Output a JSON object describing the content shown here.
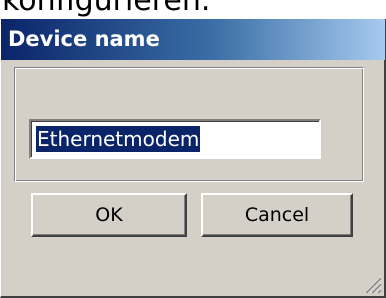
{
  "background_caption": {
    "text": "konfigurieren."
  },
  "dialog": {
    "title": "Device name",
    "title_gradient_start": "#0a246a",
    "title_gradient_end": "#a6caf0",
    "face_color": "#d4d0c8",
    "device_name_input": {
      "value": "Ethernetmodem",
      "selected": true
    },
    "buttons": {
      "ok_label": "OK",
      "cancel_label": "Cancel"
    },
    "resize_grip_icon": "size-grip-icon"
  }
}
